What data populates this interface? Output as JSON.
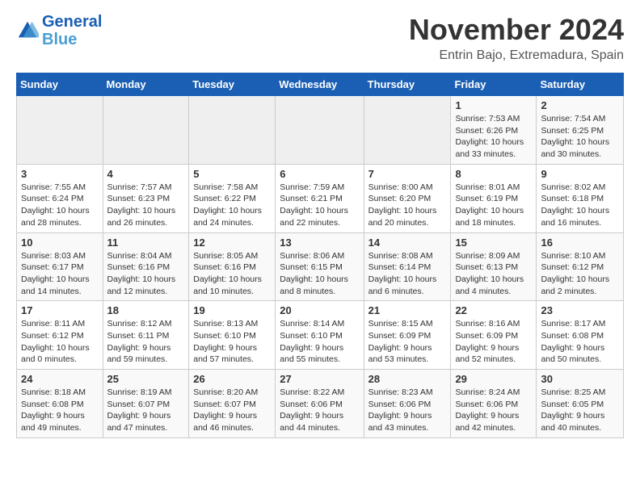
{
  "header": {
    "logo_line1": "General",
    "logo_line2": "Blue",
    "month": "November 2024",
    "location": "Entrin Bajo, Extremadura, Spain"
  },
  "weekdays": [
    "Sunday",
    "Monday",
    "Tuesday",
    "Wednesday",
    "Thursday",
    "Friday",
    "Saturday"
  ],
  "weeks": [
    [
      {
        "day": "",
        "info": ""
      },
      {
        "day": "",
        "info": ""
      },
      {
        "day": "",
        "info": ""
      },
      {
        "day": "",
        "info": ""
      },
      {
        "day": "",
        "info": ""
      },
      {
        "day": "1",
        "info": "Sunrise: 7:53 AM\nSunset: 6:26 PM\nDaylight: 10 hours and 33 minutes."
      },
      {
        "day": "2",
        "info": "Sunrise: 7:54 AM\nSunset: 6:25 PM\nDaylight: 10 hours and 30 minutes."
      }
    ],
    [
      {
        "day": "3",
        "info": "Sunrise: 7:55 AM\nSunset: 6:24 PM\nDaylight: 10 hours and 28 minutes."
      },
      {
        "day": "4",
        "info": "Sunrise: 7:57 AM\nSunset: 6:23 PM\nDaylight: 10 hours and 26 minutes."
      },
      {
        "day": "5",
        "info": "Sunrise: 7:58 AM\nSunset: 6:22 PM\nDaylight: 10 hours and 24 minutes."
      },
      {
        "day": "6",
        "info": "Sunrise: 7:59 AM\nSunset: 6:21 PM\nDaylight: 10 hours and 22 minutes."
      },
      {
        "day": "7",
        "info": "Sunrise: 8:00 AM\nSunset: 6:20 PM\nDaylight: 10 hours and 20 minutes."
      },
      {
        "day": "8",
        "info": "Sunrise: 8:01 AM\nSunset: 6:19 PM\nDaylight: 10 hours and 18 minutes."
      },
      {
        "day": "9",
        "info": "Sunrise: 8:02 AM\nSunset: 6:18 PM\nDaylight: 10 hours and 16 minutes."
      }
    ],
    [
      {
        "day": "10",
        "info": "Sunrise: 8:03 AM\nSunset: 6:17 PM\nDaylight: 10 hours and 14 minutes."
      },
      {
        "day": "11",
        "info": "Sunrise: 8:04 AM\nSunset: 6:16 PM\nDaylight: 10 hours and 12 minutes."
      },
      {
        "day": "12",
        "info": "Sunrise: 8:05 AM\nSunset: 6:16 PM\nDaylight: 10 hours and 10 minutes."
      },
      {
        "day": "13",
        "info": "Sunrise: 8:06 AM\nSunset: 6:15 PM\nDaylight: 10 hours and 8 minutes."
      },
      {
        "day": "14",
        "info": "Sunrise: 8:08 AM\nSunset: 6:14 PM\nDaylight: 10 hours and 6 minutes."
      },
      {
        "day": "15",
        "info": "Sunrise: 8:09 AM\nSunset: 6:13 PM\nDaylight: 10 hours and 4 minutes."
      },
      {
        "day": "16",
        "info": "Sunrise: 8:10 AM\nSunset: 6:12 PM\nDaylight: 10 hours and 2 minutes."
      }
    ],
    [
      {
        "day": "17",
        "info": "Sunrise: 8:11 AM\nSunset: 6:12 PM\nDaylight: 10 hours and 0 minutes."
      },
      {
        "day": "18",
        "info": "Sunrise: 8:12 AM\nSunset: 6:11 PM\nDaylight: 9 hours and 59 minutes."
      },
      {
        "day": "19",
        "info": "Sunrise: 8:13 AM\nSunset: 6:10 PM\nDaylight: 9 hours and 57 minutes."
      },
      {
        "day": "20",
        "info": "Sunrise: 8:14 AM\nSunset: 6:10 PM\nDaylight: 9 hours and 55 minutes."
      },
      {
        "day": "21",
        "info": "Sunrise: 8:15 AM\nSunset: 6:09 PM\nDaylight: 9 hours and 53 minutes."
      },
      {
        "day": "22",
        "info": "Sunrise: 8:16 AM\nSunset: 6:09 PM\nDaylight: 9 hours and 52 minutes."
      },
      {
        "day": "23",
        "info": "Sunrise: 8:17 AM\nSunset: 6:08 PM\nDaylight: 9 hours and 50 minutes."
      }
    ],
    [
      {
        "day": "24",
        "info": "Sunrise: 8:18 AM\nSunset: 6:08 PM\nDaylight: 9 hours and 49 minutes."
      },
      {
        "day": "25",
        "info": "Sunrise: 8:19 AM\nSunset: 6:07 PM\nDaylight: 9 hours and 47 minutes."
      },
      {
        "day": "26",
        "info": "Sunrise: 8:20 AM\nSunset: 6:07 PM\nDaylight: 9 hours and 46 minutes."
      },
      {
        "day": "27",
        "info": "Sunrise: 8:22 AM\nSunset: 6:06 PM\nDaylight: 9 hours and 44 minutes."
      },
      {
        "day": "28",
        "info": "Sunrise: 8:23 AM\nSunset: 6:06 PM\nDaylight: 9 hours and 43 minutes."
      },
      {
        "day": "29",
        "info": "Sunrise: 8:24 AM\nSunset: 6:06 PM\nDaylight: 9 hours and 42 minutes."
      },
      {
        "day": "30",
        "info": "Sunrise: 8:25 AM\nSunset: 6:05 PM\nDaylight: 9 hours and 40 minutes."
      }
    ]
  ]
}
